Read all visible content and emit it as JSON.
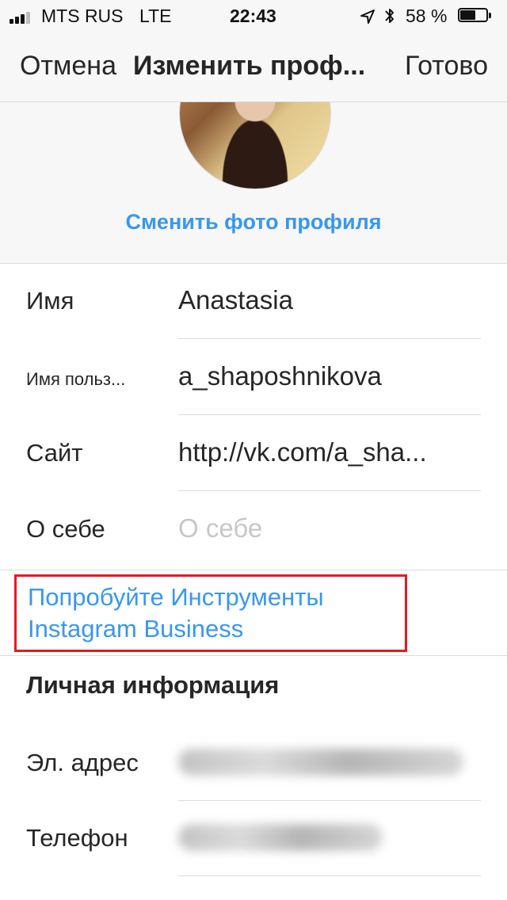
{
  "status_bar": {
    "carrier": "MTS RUS",
    "network": "LTE",
    "time": "22:43",
    "battery": "58 %",
    "battery_level": 0.58,
    "icons": [
      "signal-icon",
      "location-arrow-icon",
      "bluetooth-icon",
      "battery-icon"
    ]
  },
  "nav": {
    "cancel": "Отмена",
    "title": "Изменить проф...",
    "done": "Готово"
  },
  "profile": {
    "change_photo": "Сменить фото профиля"
  },
  "fields": [
    {
      "label": "Имя",
      "value": "Anastasia"
    },
    {
      "label": "Имя польз...",
      "value": "a_shaposhnikova"
    },
    {
      "label": "Сайт",
      "value": "http://vk.com/a_sha..."
    },
    {
      "label": "О себе",
      "placeholder": "О себе"
    }
  ],
  "business": {
    "line1": "Попробуйте Инструменты",
    "line2": "Instagram Business"
  },
  "personal": {
    "title": "Личная информация",
    "email_label": "Эл. адрес",
    "phone_label": "Телефон"
  },
  "colors": {
    "accent": "#3897f0",
    "highlight": "#e8191e",
    "text": "#262626",
    "placeholder": "#c7c7c7"
  }
}
